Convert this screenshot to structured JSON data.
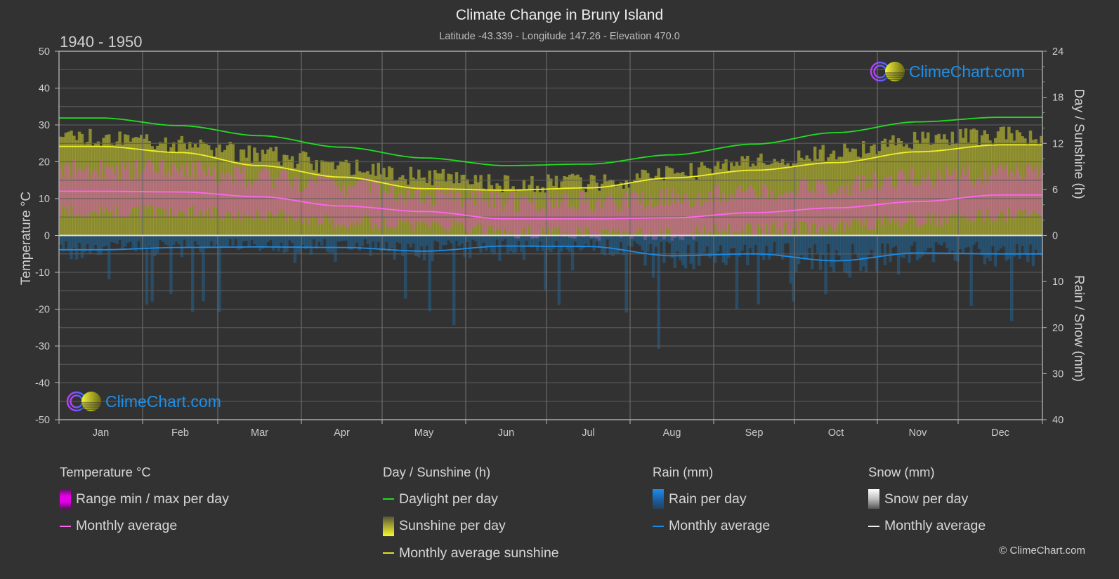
{
  "title": "Climate Change in Bruny Island",
  "subtitle": "Latitude -43.339 - Longitude 147.26 - Elevation 470.0",
  "period": "1940 - 1950",
  "logo_text": "ClimeChart.com",
  "copyright": "© ClimeChart.com",
  "colors": {
    "background": "#323232",
    "temp_range": "#e400e4",
    "temp_avg": "#ff66ee",
    "daylight": "#22dd22",
    "sunshine": "#e8e830",
    "sunshine_avg": "#f0f028",
    "rain": "#1e88e5",
    "rain_avg": "#1a8ce8",
    "snow": "#ffffff"
  },
  "legend": {
    "temperature": {
      "head": "Temperature °C",
      "range": "Range min / max per day",
      "avg": "Monthly average"
    },
    "sunshine": {
      "head": "Day / Sunshine (h)",
      "daylight": "Daylight per day",
      "sunshine": "Sunshine per day",
      "avg": "Monthly average sunshine"
    },
    "rain": {
      "head": "Rain (mm)",
      "per_day": "Rain per day",
      "avg": "Monthly average"
    },
    "snow": {
      "head": "Snow (mm)",
      "per_day": "Snow per day",
      "avg": "Monthly average"
    }
  },
  "chart_data": {
    "type": "line",
    "title": "Climate Change in Bruny Island",
    "subtitle": "Latitude -43.339 - Longitude 147.26 - Elevation 470.0",
    "categories": [
      "Jan",
      "Feb",
      "Mar",
      "Apr",
      "May",
      "Jun",
      "Jul",
      "Aug",
      "Sep",
      "Oct",
      "Nov",
      "Dec"
    ],
    "axes": {
      "left": {
        "label": "Temperature °C",
        "range": [
          -50,
          50
        ],
        "ticks": [
          "50",
          "40",
          "30",
          "20",
          "10",
          "0",
          "-10",
          "-20",
          "-30",
          "-40",
          "-50"
        ]
      },
      "right_top": {
        "label": "Day / Sunshine (h)",
        "range": [
          0,
          24
        ],
        "ticks": [
          "24",
          "18",
          "12",
          "6",
          "0"
        ]
      },
      "right_bottom": {
        "label": "Rain / Snow (mm)",
        "range": [
          0,
          40
        ],
        "ticks": [
          "0",
          "10",
          "20",
          "30",
          "40"
        ]
      }
    },
    "grid": true,
    "series": [
      {
        "name": "Daylight per day",
        "unit": "h",
        "values": [
          15.3,
          14.3,
          13.0,
          11.5,
          10.1,
          9.1,
          9.3,
          10.5,
          11.9,
          13.4,
          14.8,
          15.4
        ]
      },
      {
        "name": "Monthly average sunshine",
        "unit": "h",
        "values": [
          11.6,
          10.8,
          9.1,
          7.6,
          6.1,
          5.9,
          6.2,
          7.5,
          8.5,
          9.5,
          10.9,
          11.8
        ]
      },
      {
        "name": "Temperature monthly average",
        "unit": "°C",
        "values": [
          12.0,
          11.8,
          10.5,
          8.0,
          6.5,
          4.5,
          4.5,
          4.8,
          6.2,
          7.5,
          9.2,
          11.0
        ]
      },
      {
        "name": "Temperature daily max (approx)",
        "unit": "°C",
        "values": [
          17.5,
          17.0,
          15.5,
          13.0,
          10.5,
          8.5,
          8.5,
          9.5,
          11.5,
          13.0,
          15.0,
          16.5
        ]
      },
      {
        "name": "Temperature daily min (approx)",
        "unit": "°C",
        "values": [
          7.0,
          7.0,
          6.0,
          4.0,
          3.0,
          1.5,
          1.0,
          1.0,
          2.0,
          3.0,
          4.5,
          6.0
        ]
      },
      {
        "name": "Rain monthly average",
        "unit": "mm",
        "values": [
          3.1,
          2.6,
          2.5,
          2.6,
          3.4,
          2.3,
          2.4,
          4.4,
          4.0,
          5.5,
          3.8,
          4.0
        ]
      },
      {
        "name": "Snow monthly average",
        "unit": "mm",
        "values": [
          0,
          0,
          0,
          0,
          0,
          0,
          0,
          0,
          0,
          0,
          0,
          0
        ]
      }
    ]
  }
}
